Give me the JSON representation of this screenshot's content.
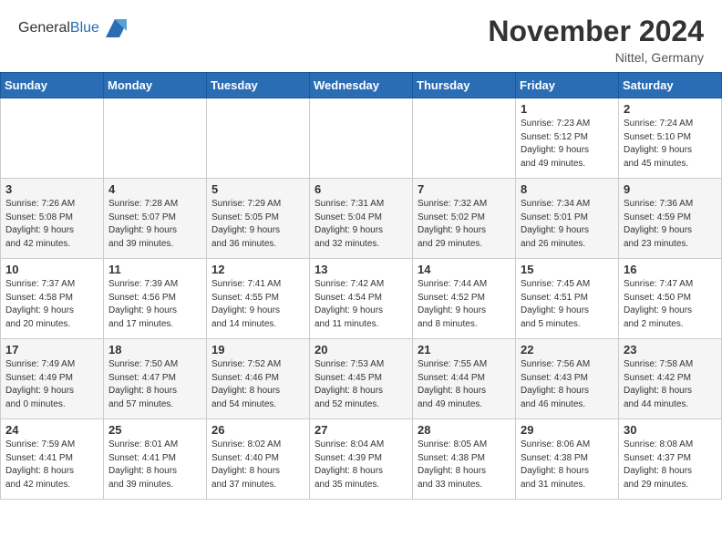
{
  "header": {
    "title": "November 2024",
    "location": "Nittel, Germany",
    "logo_general": "General",
    "logo_blue": "Blue"
  },
  "days_of_week": [
    "Sunday",
    "Monday",
    "Tuesday",
    "Wednesday",
    "Thursday",
    "Friday",
    "Saturday"
  ],
  "weeks": [
    [
      {
        "day": "",
        "info": ""
      },
      {
        "day": "",
        "info": ""
      },
      {
        "day": "",
        "info": ""
      },
      {
        "day": "",
        "info": ""
      },
      {
        "day": "",
        "info": ""
      },
      {
        "day": "1",
        "info": "Sunrise: 7:23 AM\nSunset: 5:12 PM\nDaylight: 9 hours\nand 49 minutes."
      },
      {
        "day": "2",
        "info": "Sunrise: 7:24 AM\nSunset: 5:10 PM\nDaylight: 9 hours\nand 45 minutes."
      }
    ],
    [
      {
        "day": "3",
        "info": "Sunrise: 7:26 AM\nSunset: 5:08 PM\nDaylight: 9 hours\nand 42 minutes."
      },
      {
        "day": "4",
        "info": "Sunrise: 7:28 AM\nSunset: 5:07 PM\nDaylight: 9 hours\nand 39 minutes."
      },
      {
        "day": "5",
        "info": "Sunrise: 7:29 AM\nSunset: 5:05 PM\nDaylight: 9 hours\nand 36 minutes."
      },
      {
        "day": "6",
        "info": "Sunrise: 7:31 AM\nSunset: 5:04 PM\nDaylight: 9 hours\nand 32 minutes."
      },
      {
        "day": "7",
        "info": "Sunrise: 7:32 AM\nSunset: 5:02 PM\nDaylight: 9 hours\nand 29 minutes."
      },
      {
        "day": "8",
        "info": "Sunrise: 7:34 AM\nSunset: 5:01 PM\nDaylight: 9 hours\nand 26 minutes."
      },
      {
        "day": "9",
        "info": "Sunrise: 7:36 AM\nSunset: 4:59 PM\nDaylight: 9 hours\nand 23 minutes."
      }
    ],
    [
      {
        "day": "10",
        "info": "Sunrise: 7:37 AM\nSunset: 4:58 PM\nDaylight: 9 hours\nand 20 minutes."
      },
      {
        "day": "11",
        "info": "Sunrise: 7:39 AM\nSunset: 4:56 PM\nDaylight: 9 hours\nand 17 minutes."
      },
      {
        "day": "12",
        "info": "Sunrise: 7:41 AM\nSunset: 4:55 PM\nDaylight: 9 hours\nand 14 minutes."
      },
      {
        "day": "13",
        "info": "Sunrise: 7:42 AM\nSunset: 4:54 PM\nDaylight: 9 hours\nand 11 minutes."
      },
      {
        "day": "14",
        "info": "Sunrise: 7:44 AM\nSunset: 4:52 PM\nDaylight: 9 hours\nand 8 minutes."
      },
      {
        "day": "15",
        "info": "Sunrise: 7:45 AM\nSunset: 4:51 PM\nDaylight: 9 hours\nand 5 minutes."
      },
      {
        "day": "16",
        "info": "Sunrise: 7:47 AM\nSunset: 4:50 PM\nDaylight: 9 hours\nand 2 minutes."
      }
    ],
    [
      {
        "day": "17",
        "info": "Sunrise: 7:49 AM\nSunset: 4:49 PM\nDaylight: 9 hours\nand 0 minutes."
      },
      {
        "day": "18",
        "info": "Sunrise: 7:50 AM\nSunset: 4:47 PM\nDaylight: 8 hours\nand 57 minutes."
      },
      {
        "day": "19",
        "info": "Sunrise: 7:52 AM\nSunset: 4:46 PM\nDaylight: 8 hours\nand 54 minutes."
      },
      {
        "day": "20",
        "info": "Sunrise: 7:53 AM\nSunset: 4:45 PM\nDaylight: 8 hours\nand 52 minutes."
      },
      {
        "day": "21",
        "info": "Sunrise: 7:55 AM\nSunset: 4:44 PM\nDaylight: 8 hours\nand 49 minutes."
      },
      {
        "day": "22",
        "info": "Sunrise: 7:56 AM\nSunset: 4:43 PM\nDaylight: 8 hours\nand 46 minutes."
      },
      {
        "day": "23",
        "info": "Sunrise: 7:58 AM\nSunset: 4:42 PM\nDaylight: 8 hours\nand 44 minutes."
      }
    ],
    [
      {
        "day": "24",
        "info": "Sunrise: 7:59 AM\nSunset: 4:41 PM\nDaylight: 8 hours\nand 42 minutes."
      },
      {
        "day": "25",
        "info": "Sunrise: 8:01 AM\nSunset: 4:41 PM\nDaylight: 8 hours\nand 39 minutes."
      },
      {
        "day": "26",
        "info": "Sunrise: 8:02 AM\nSunset: 4:40 PM\nDaylight: 8 hours\nand 37 minutes."
      },
      {
        "day": "27",
        "info": "Sunrise: 8:04 AM\nSunset: 4:39 PM\nDaylight: 8 hours\nand 35 minutes."
      },
      {
        "day": "28",
        "info": "Sunrise: 8:05 AM\nSunset: 4:38 PM\nDaylight: 8 hours\nand 33 minutes."
      },
      {
        "day": "29",
        "info": "Sunrise: 8:06 AM\nSunset: 4:38 PM\nDaylight: 8 hours\nand 31 minutes."
      },
      {
        "day": "30",
        "info": "Sunrise: 8:08 AM\nSunset: 4:37 PM\nDaylight: 8 hours\nand 29 minutes."
      }
    ]
  ]
}
